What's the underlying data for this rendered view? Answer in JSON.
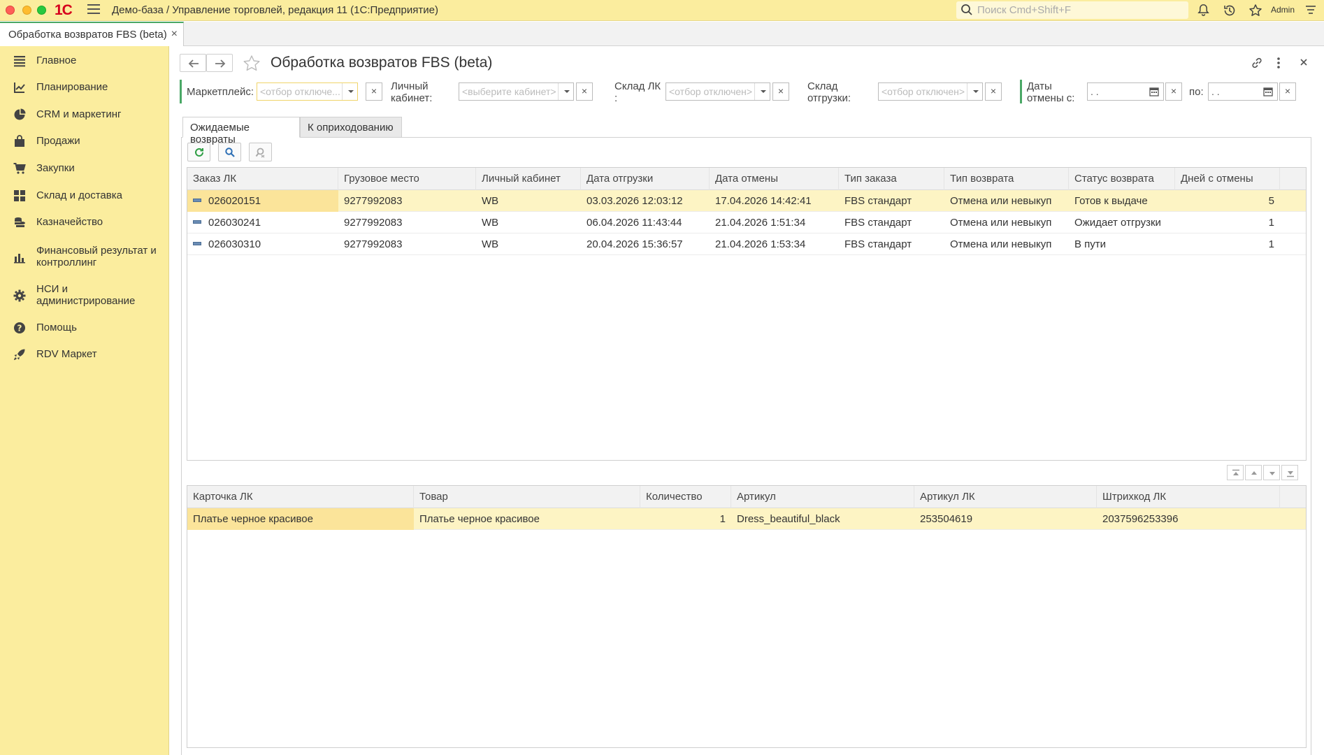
{
  "window": {
    "logo": "1С",
    "title": "Демо-база / Управление торговлей, редакция 11  (1С:Предприятие)",
    "search_placeholder": "Поиск Cmd+Shift+F",
    "user": "Admin"
  },
  "open_tab": {
    "label": "Обработка возвратов FBS (beta)",
    "close": "×"
  },
  "sidebar": {
    "items": [
      {
        "label": "Главное",
        "icon": "menu-lines-icon"
      },
      {
        "label": "Планирование",
        "icon": "planning-chart-icon"
      },
      {
        "label": "CRM и маркетинг",
        "icon": "pie-chart-icon"
      },
      {
        "label": "Продажи",
        "icon": "shopping-bag-icon"
      },
      {
        "label": "Закупки",
        "icon": "cart-icon"
      },
      {
        "label": "Склад и доставка",
        "icon": "grid-icon"
      },
      {
        "label": "Казначейство",
        "icon": "coins-icon"
      },
      {
        "label": "Финансовый результат и контроллинг",
        "icon": "bar-chart-icon"
      },
      {
        "label": "НСИ и администрирование",
        "icon": "gear-icon"
      },
      {
        "label": "Помощь",
        "icon": "help-icon"
      },
      {
        "label": "RDV Маркет",
        "icon": "rocket-icon"
      }
    ]
  },
  "form": {
    "title": "Обработка возвратов FBS (beta)",
    "filters": {
      "marketplace_label": "Маркетплейс:",
      "marketplace_placeholder": "<отбор отключе...",
      "cabinet_label_1": "Личный",
      "cabinet_label_2": "кабинет:",
      "cabinet_placeholder": "<выберите кабинет>",
      "warehouse_lk_label_1": "Склад ЛК",
      "warehouse_lk_label_2": ":",
      "warehouse_lk_placeholder": "<отбор отключен>",
      "warehouse_ship_label_1": "Склад",
      "warehouse_ship_label_2": "отгрузки:",
      "warehouse_ship_placeholder": "<отбор отключен>",
      "dates_label_1": "Даты",
      "dates_label_2": "отмены с:",
      "date_from_value": " .  .",
      "date_to_label": "по:",
      "date_to_value": " .  .",
      "clear": "×"
    },
    "tabs": [
      {
        "label": "Ожидаемые возвраты",
        "active": true
      },
      {
        "label": "К оприходованию",
        "active": false
      }
    ],
    "orders_table": {
      "columns": [
        "Заказ ЛК",
        "Грузовое место",
        "Личный кабинет",
        "Дата отгрузки",
        "Дата отмены",
        "Тип заказа",
        "Тип возврата",
        "Статус возврата",
        "Дней с отмены"
      ],
      "rows": [
        [
          "026020151",
          "9277992083",
          "WB",
          "03.03.2026 12:03:12",
          "17.04.2026 14:42:41",
          "FBS стандарт",
          "Отмена или невыкуп",
          "Готов к выдаче",
          "5"
        ],
        [
          "026030241",
          "9277992083",
          "WB",
          "06.04.2026 11:43:44",
          "21.04.2026 1:51:34",
          "FBS стандарт",
          "Отмена или невыкуп",
          "Ожидает отгрузки",
          "1"
        ],
        [
          "026030310",
          "9277992083",
          "WB",
          "20.04.2026 15:36:57",
          "21.04.2026 1:53:34",
          "FBS стандарт",
          "Отмена или невыкуп",
          "В пути",
          "1"
        ]
      ]
    },
    "items_table": {
      "columns": [
        "Карточка ЛК",
        "Товар",
        "Количество",
        "Артикул",
        "Артикул ЛК",
        "Штрихкод ЛК"
      ],
      "rows": [
        [
          "Платье черное красивое",
          "Платье черное красивое",
          "1",
          "Dress_beautiful_black",
          "253504619",
          "2037596253396"
        ]
      ]
    }
  },
  "colors": {
    "accent_yellow": "#fbed9e",
    "selection": "#fdf4c4",
    "current_cell": "#fbe49a",
    "green_marker": "#4aa866",
    "brand_red": "#d6001c"
  }
}
